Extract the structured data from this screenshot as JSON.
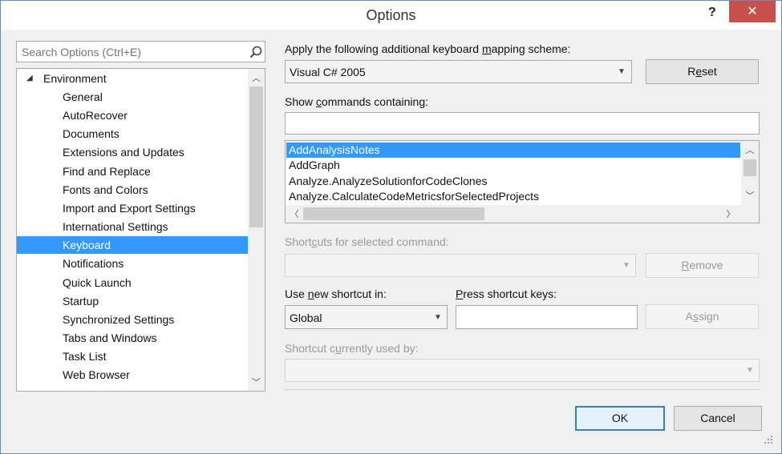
{
  "window": {
    "title": "Options",
    "help_label": "?",
    "close_label": "✕"
  },
  "search": {
    "placeholder": "Search Options (Ctrl+E)"
  },
  "tree": {
    "root": {
      "label": "Environment",
      "expanded": true
    },
    "children": [
      "General",
      "AutoRecover",
      "Documents",
      "Extensions and Updates",
      "Find and Replace",
      "Fonts and Colors",
      "Import and Export Settings",
      "International Settings",
      "Keyboard",
      "Notifications",
      "Quick Launch",
      "Startup",
      "Synchronized Settings",
      "Tabs and Windows",
      "Task List",
      "Web Browser"
    ],
    "selected": "Keyboard"
  },
  "mapping": {
    "label_pre": "Apply the following additional keyboard ",
    "label_ak": "m",
    "label_post": "apping scheme:",
    "value": "Visual C# 2005",
    "reset_pre": "R",
    "reset_ak": "e",
    "reset_post": "set"
  },
  "show_commands": {
    "label_pre": "Show ",
    "label_ak": "c",
    "label_post": "ommands containing:",
    "value": ""
  },
  "commands": {
    "items": [
      "AddAnalysisNotes",
      "AddGraph",
      "Analyze.AnalyzeSolutionforCodeClones",
      "Analyze.CalculateCodeMetricsforSelectedProjects"
    ],
    "selected": "AddAnalysisNotes"
  },
  "shortcuts_selected": {
    "label_pre": "Short",
    "label_ak": "c",
    "label_post": "uts for selected command:",
    "value": "",
    "remove_pre": "",
    "remove_ak": "R",
    "remove_post": "emove"
  },
  "use_new_shortcut": {
    "label_pre": "Use ",
    "label_ak": "n",
    "label_post": "ew shortcut in:",
    "value": "Global"
  },
  "press_keys": {
    "label_pre": "",
    "label_ak": "P",
    "label_post": "ress shortcut keys:",
    "value": "",
    "assign_pre": "A",
    "assign_ak": "s",
    "assign_post": "sign"
  },
  "currently_used": {
    "label_pre": "Shortcut c",
    "label_ak": "u",
    "label_post": "rrently used by:",
    "value": ""
  },
  "footer": {
    "ok_label": "OK",
    "cancel_label": "Cancel"
  },
  "colors": {
    "accent": "#3399ff",
    "close_button": "#c7504a",
    "border": "#5b8fc9"
  }
}
